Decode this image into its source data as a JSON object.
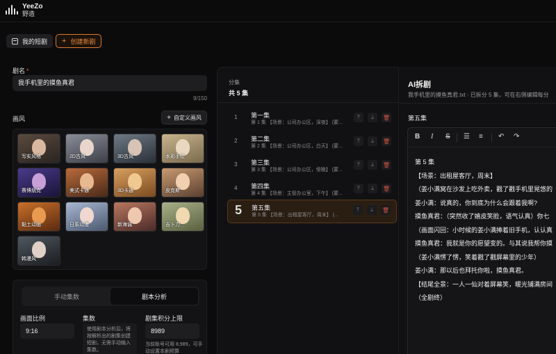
{
  "app": {
    "name_en": "YeeZo",
    "name_cn": "野造"
  },
  "tabs": {
    "my_drama": "我的短剧",
    "create_new": "创建新剧"
  },
  "form": {
    "title_label": "剧名",
    "required_mark": "*",
    "title_value": "我手机里的摸鱼真君",
    "title_counter": "9/150",
    "style_label": "画风",
    "custom_style_button": "自定义画风"
  },
  "styles": [
    {
      "label": "写实风格",
      "colors": [
        "#5a4a3e",
        "#2a2420"
      ],
      "face": "#d9b8a0"
    },
    {
      "label": "2D古风",
      "colors": [
        "#8a8e98",
        "#3c3f48"
      ],
      "face": "#e8d6cc"
    },
    {
      "label": "3D古风",
      "colors": [
        "#6e7a86",
        "#2a3038"
      ],
      "face": "#d8c4b6"
    },
    {
      "label": "水彩手绘",
      "colors": [
        "#c8b48c",
        "#7a6a4e"
      ],
      "face": "#e8d8c0"
    },
    {
      "label": "赛博朋克",
      "colors": [
        "#4a3a8a",
        "#1a1438"
      ],
      "face": "#c8a0d8"
    },
    {
      "label": "美式卡通",
      "colors": [
        "#b86a3a",
        "#4a2a1a"
      ],
      "face": "#e8b890"
    },
    {
      "label": "3D卡通",
      "colors": [
        "#d8a060",
        "#7a4a20"
      ],
      "face": "#f0c890"
    },
    {
      "label": "皮克斯",
      "colors": [
        "#c89a70",
        "#5a4030"
      ],
      "face": "#f0d0b0"
    },
    {
      "label": "黏土动画",
      "colors": [
        "#c8702a",
        "#5a2a10"
      ],
      "face": "#e89a50"
    },
    {
      "label": "日系动漫",
      "colors": [
        "#a8b8d0",
        "#4a5870"
      ],
      "face": "#f0d8d0"
    },
    {
      "label": "新海诚",
      "colors": [
        "#b87860",
        "#4a2a28"
      ],
      "face": "#f0c8b0"
    },
    {
      "label": "吉卜力",
      "colors": [
        "#a8b088",
        "#5a6040"
      ],
      "face": "#f0d8b0"
    },
    {
      "label": "韩漫风",
      "colors": [
        "#505860",
        "#1a1c20"
      ],
      "face": "#e0d0c8"
    }
  ],
  "analysis": {
    "tab_manual": "手动集数",
    "tab_script": "剧本分析",
    "ratio_label": "画面比例",
    "ratio_value": "9:16",
    "episodes_label": "集数",
    "episodes_note": "使用剧本分析后，将按解析出的剧集创建短剧，无需手动输入集数。",
    "credits_label": "剧集积分上限",
    "credits_value": "8989",
    "credits_note": "当前账号可用 8,989，可手动设置本剧预算"
  },
  "episodes": {
    "header_small": "分集",
    "header_count": "共 5 集",
    "items": [
      {
        "num": "1",
        "title": "第一集",
        "sub": "第 1 集 【场景：公司办公区，深夜】 (蒙..."
      },
      {
        "num": "2",
        "title": "第二集",
        "sub": "第 2 集 【场景：公司办公区，白天】 (蒙..."
      },
      {
        "num": "3",
        "title": "第三集",
        "sub": "第 3 集 【场景：公司办公区，傍晚】 (蒙..."
      },
      {
        "num": "4",
        "title": "第四集",
        "sub": "第 4 集 【场景：主管办公室，下午】 (蒙..."
      },
      {
        "num": "5",
        "title": "第五集",
        "sub": "第 5 集 【场景：出租屋客厅，周末】 (..."
      }
    ]
  },
  "ai": {
    "title": "AI拆剧",
    "subtitle": "我手机里的摸鱼真君.txt · 已拆分 5 集，可在右侧编辑每分",
    "current_episode": "第五集",
    "toolbar": [
      "B",
      "I",
      "S",
      "☰",
      "≡",
      "↶",
      "↷"
    ],
    "content": [
      "第 5 集",
      "【场景：出租屋客厅，周末】",
      "（姜小满窝在沙发上吃外卖，戳了戳手机里晃悠的",
      "姜小满：说真的，你到底为什么会跟着我啊?",
      "摸鱼真君：（突然收了嬉皮笑脸，语气认真）你七",
      "（画面闪回：小时候的姜小满捧着旧手机，认认真",
      "摸鱼真君：我就是你的愿望变的。与其说我帮你摸",
      "（姜小满愣了愣，笑着戳了戳屏幕里的少年）",
      "姜小满：那以后也拜托你啦，摸鱼真君。",
      "【结尾全景：一人一仙对着屏幕笑，暖光铺满房间",
      "（全剧终）"
    ]
  },
  "colors": {
    "accent": "#e07a2e",
    "danger": "#d0523e",
    "bg": "#0b0b0c"
  }
}
